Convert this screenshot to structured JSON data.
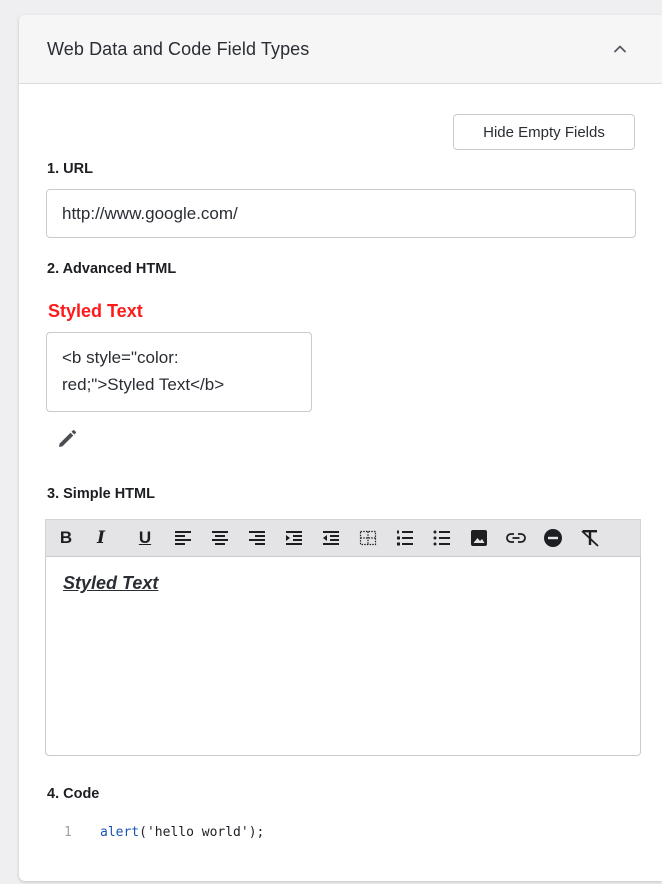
{
  "panel": {
    "title": "Web Data and Code Field Types",
    "hide_empty_label": "Hide Empty Fields"
  },
  "fields": {
    "url": {
      "label": "1. URL",
      "value": "http://www.google.com/"
    },
    "advanced_html": {
      "label": "2. Advanced HTML",
      "preview": "Styled Text",
      "preview_color": "#ff1a1a",
      "source_line1": "<b style=\"color:",
      "source_line2": "red;\">Styled Text</b>"
    },
    "simple_html": {
      "label": "3. Simple HTML",
      "toolbar": {
        "bold": "B",
        "italic": "I",
        "underline": "U",
        "icons": [
          "align-left-icon",
          "align-center-icon",
          "align-right-icon",
          "indent-icon",
          "outdent-icon",
          "table-icon",
          "ordered-list-icon",
          "unordered-list-icon",
          "image-icon",
          "link-icon",
          "horizontal-rule-icon",
          "clear-format-icon"
        ]
      },
      "content": "Styled Text"
    },
    "code": {
      "label": "4. Code",
      "line_number": "1",
      "fn": "alert",
      "open": "(",
      "string": "'hello world'",
      "close": ");"
    }
  },
  "colors": {
    "page_bg": "#efeff1",
    "header_bg": "#f6f6f7",
    "toolbar_bg": "#e4e4e7",
    "code_fn": "#1a55b5"
  }
}
